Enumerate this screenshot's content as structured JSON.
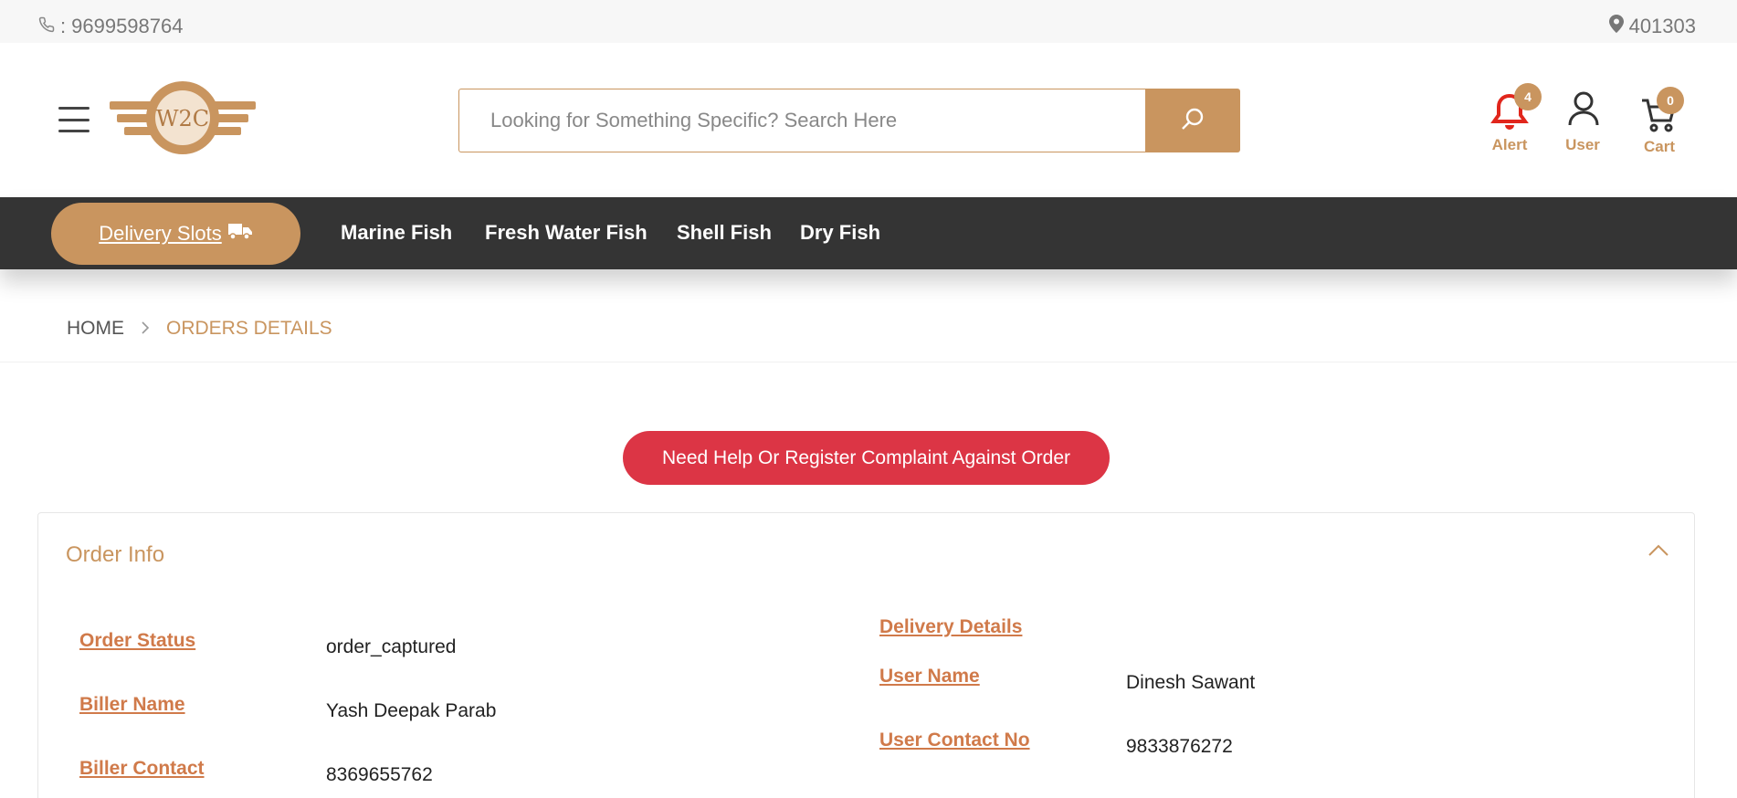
{
  "topbar": {
    "phone_prefix": ": ",
    "phone": "9699598764",
    "pincode": "401303"
  },
  "header": {
    "logo_text": "W2C",
    "search_placeholder": "Looking for Something Specific? Search Here",
    "alert": {
      "label": "Alert",
      "count": "4"
    },
    "user": {
      "label": "User"
    },
    "cart": {
      "label": "Cart",
      "count": "0"
    }
  },
  "nav": {
    "delivery_label": "Delivery Slots",
    "links": [
      "Marine Fish",
      "Fresh Water Fish",
      "Shell Fish",
      "Dry Fish"
    ]
  },
  "breadcrumb": {
    "home": "HOME",
    "current": "ORDERS DETAILS"
  },
  "help_button": "Need Help Or Register Complaint Against Order",
  "order_info": {
    "title": "Order Info",
    "left": [
      {
        "label": "Order Status",
        "value": "order_captured"
      },
      {
        "label": "Biller Name",
        "value": "Yash Deepak Parab"
      },
      {
        "label": "Biller Contact",
        "value": "8369655762"
      }
    ],
    "delivery_heading": "Delivery Details",
    "right": [
      {
        "label": "User Name",
        "value": "Dinesh Sawant"
      },
      {
        "label": "User Contact No",
        "value": "9833876272"
      }
    ]
  },
  "colors": {
    "accent": "#c9955f",
    "nav_bg": "#343434",
    "danger": "#dc3545",
    "label": "#d07a4a"
  }
}
